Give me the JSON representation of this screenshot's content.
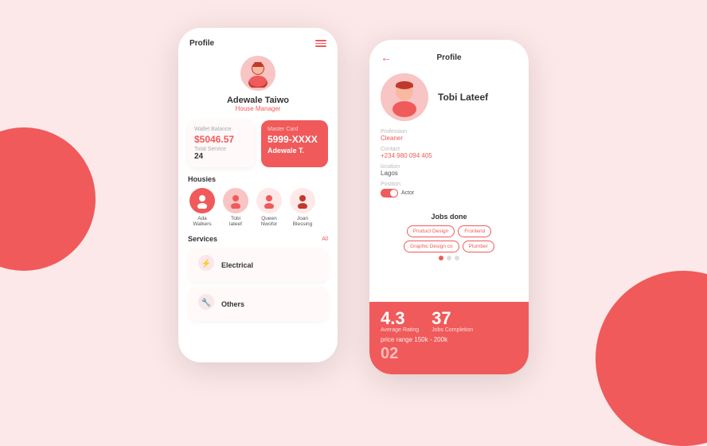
{
  "background": {
    "color": "#fce8e8",
    "accent": "#f05a5a"
  },
  "phone1": {
    "header": {
      "title": "Profile",
      "menu_icon_label": "menu"
    },
    "user": {
      "name": "Adewale Taiwo",
      "role": "House Manager"
    },
    "wallet": {
      "label": "Wallet Balance",
      "value": "$5046.57",
      "service_label": "Total Service",
      "service_value": "24"
    },
    "card": {
      "label": "Master Card",
      "number": "5999-XXXX",
      "holder": "Adewale T."
    },
    "housies_label": "Housies",
    "housies": [
      {
        "name": "Ada\nWalkers",
        "bg": "red"
      },
      {
        "name": "Tobi\nlateef",
        "bg": "pink"
      },
      {
        "name": "Queen\nNwofor",
        "bg": "light"
      },
      {
        "name": "Joan\nBlessing",
        "bg": "light"
      }
    ],
    "services_label": "Services",
    "services_all": "All",
    "services": [
      {
        "name": "Electrical",
        "icon": "⚡"
      },
      {
        "name": "Others",
        "icon": "🔧"
      }
    ]
  },
  "phone2": {
    "header": {
      "title": "Profile",
      "back_label": "back"
    },
    "user": {
      "name": "Tobi Lateef"
    },
    "profession_label": "Profession",
    "profession_value": "Cleaner",
    "contact_label": "Contact",
    "contact_value": "+234 980 094 405",
    "location_label": "location",
    "location_value": "Lagos",
    "position_label": "Position",
    "position_value": "Actor",
    "toggle_label": "Actor",
    "jobs_done_label": "Jobs done",
    "job_tags": [
      "Product Design",
      "Frontend",
      "Graphic Design co",
      "Plumber"
    ],
    "rating_label": "Average Rating",
    "rating_value": "4.3",
    "jobs_label": "Jobs Completion",
    "jobs_value": "37",
    "price_range_label": "price range",
    "price_range": "150k - 200k",
    "bottom_number": "02"
  }
}
